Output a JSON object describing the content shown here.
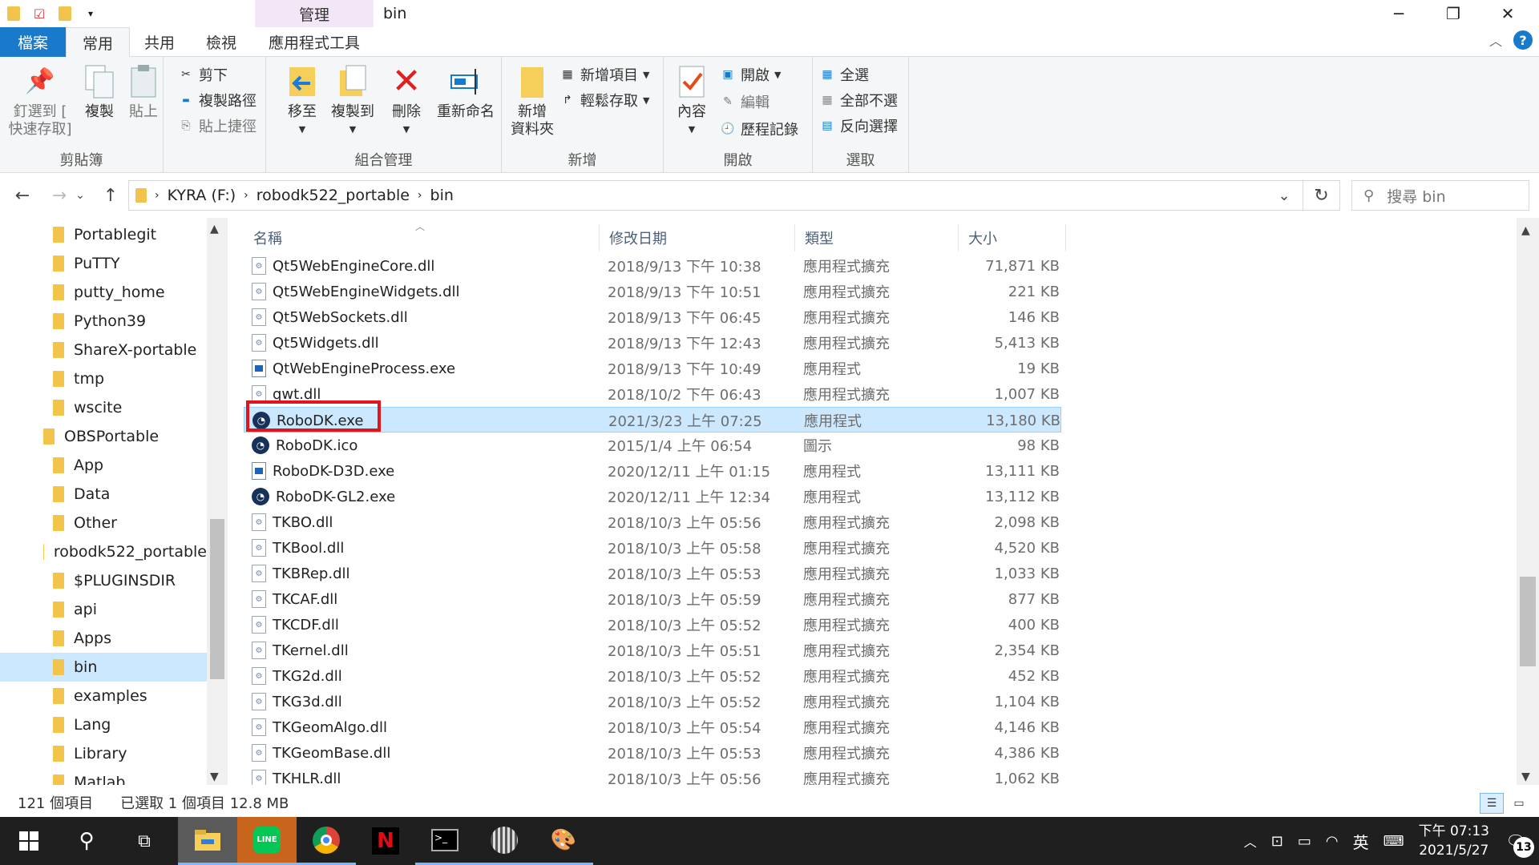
{
  "window": {
    "title": "bin",
    "context_tab": "管理",
    "controls": {
      "minimize": "─",
      "maximize": "❐",
      "close": "✕"
    }
  },
  "ribbon_tabs": [
    {
      "label": "檔案"
    },
    {
      "label": "常用"
    },
    {
      "label": "共用"
    },
    {
      "label": "檢視"
    },
    {
      "label": "應用程式工具"
    }
  ],
  "help_label": "?",
  "ribbon": {
    "clipboard": {
      "label": "剪貼簿",
      "pin": "釘選到 [\n快速存取]",
      "copy": "複製",
      "paste": "貼上",
      "cut": "剪下",
      "copy_path": "複製路徑",
      "paste_shortcut": "貼上捷徑"
    },
    "organize": {
      "label": "組合管理",
      "move_to": "移至",
      "copy_to": "複製到",
      "delete": "刪除",
      "rename": "重新命名"
    },
    "new": {
      "label": "新增",
      "new_folder": "新增\n資料夾",
      "new_item": "新增項目",
      "easy_access": "輕鬆存取"
    },
    "open": {
      "label": "開啟",
      "properties": "內容",
      "open": "開啟",
      "edit": "編輯",
      "history": "歷程記錄"
    },
    "select": {
      "label": "選取",
      "select_all": "全選",
      "select_none": "全部不選",
      "invert": "反向選擇"
    }
  },
  "address": {
    "crumbs": [
      "KYRA (F:)",
      "robodk522_portable",
      "bin"
    ],
    "search_placeholder": "搜尋 bin"
  },
  "nav_tree": [
    {
      "label": "Portablegit",
      "level": 2
    },
    {
      "label": "PuTTY",
      "level": 2
    },
    {
      "label": "putty_home",
      "level": 2
    },
    {
      "label": "Python39",
      "level": 2
    },
    {
      "label": "ShareX-portable",
      "level": 2
    },
    {
      "label": "tmp",
      "level": 2
    },
    {
      "label": "wscite",
      "level": 2
    },
    {
      "label": "OBSPortable",
      "level": 1
    },
    {
      "label": "App",
      "level": 2
    },
    {
      "label": "Data",
      "level": 2
    },
    {
      "label": "Other",
      "level": 2
    },
    {
      "label": "robodk522_portable",
      "level": 1
    },
    {
      "label": "$PLUGINSDIR",
      "level": 2
    },
    {
      "label": "api",
      "level": 2
    },
    {
      "label": "Apps",
      "level": 2
    },
    {
      "label": "bin",
      "level": 2,
      "selected": true
    },
    {
      "label": "examples",
      "level": 2
    },
    {
      "label": "Lang",
      "level": 2
    },
    {
      "label": "Library",
      "level": 2
    },
    {
      "label": "Matlab",
      "level": 2
    }
  ],
  "columns": {
    "name": "名稱",
    "date": "修改日期",
    "type": "類型",
    "size": "大小"
  },
  "files": [
    {
      "name": "Qt5WebEngineCore.dll",
      "date": "2018/9/13 下午 10:38",
      "type": "應用程式擴充",
      "size": "71,871 KB",
      "icon": "dll"
    },
    {
      "name": "Qt5WebEngineWidgets.dll",
      "date": "2018/9/13 下午 10:51",
      "type": "應用程式擴充",
      "size": "221 KB",
      "icon": "dll"
    },
    {
      "name": "Qt5WebSockets.dll",
      "date": "2018/9/13 下午 06:45",
      "type": "應用程式擴充",
      "size": "146 KB",
      "icon": "dll"
    },
    {
      "name": "Qt5Widgets.dll",
      "date": "2018/9/13 下午 12:43",
      "type": "應用程式擴充",
      "size": "5,413 KB",
      "icon": "dll"
    },
    {
      "name": "QtWebEngineProcess.exe",
      "date": "2018/9/13 下午 10:49",
      "type": "應用程式",
      "size": "19 KB",
      "icon": "exe"
    },
    {
      "name": "qwt.dll",
      "date": "2018/10/2 下午 06:43",
      "type": "應用程式擴充",
      "size": "1,007 KB",
      "icon": "dll"
    },
    {
      "name": "RoboDK.exe",
      "date": "2021/3/23 上午 07:25",
      "type": "應用程式",
      "size": "13,180 KB",
      "icon": "robo",
      "selected": true
    },
    {
      "name": "RoboDK.ico",
      "date": "2015/1/4 上午 06:54",
      "type": "圖示",
      "size": "98 KB",
      "icon": "robo"
    },
    {
      "name": "RoboDK-D3D.exe",
      "date": "2020/12/11 上午 01:15",
      "type": "應用程式",
      "size": "13,111 KB",
      "icon": "exe"
    },
    {
      "name": "RoboDK-GL2.exe",
      "date": "2020/12/11 上午 12:34",
      "type": "應用程式",
      "size": "13,112 KB",
      "icon": "robo"
    },
    {
      "name": "TKBO.dll",
      "date": "2018/10/3 上午 05:56",
      "type": "應用程式擴充",
      "size": "2,098 KB",
      "icon": "dll"
    },
    {
      "name": "TKBool.dll",
      "date": "2018/10/3 上午 05:58",
      "type": "應用程式擴充",
      "size": "4,520 KB",
      "icon": "dll"
    },
    {
      "name": "TKBRep.dll",
      "date": "2018/10/3 上午 05:53",
      "type": "應用程式擴充",
      "size": "1,033 KB",
      "icon": "dll"
    },
    {
      "name": "TKCAF.dll",
      "date": "2018/10/3 上午 05:59",
      "type": "應用程式擴充",
      "size": "877 KB",
      "icon": "dll"
    },
    {
      "name": "TKCDF.dll",
      "date": "2018/10/3 上午 05:52",
      "type": "應用程式擴充",
      "size": "400 KB",
      "icon": "dll"
    },
    {
      "name": "TKernel.dll",
      "date": "2018/10/3 上午 05:51",
      "type": "應用程式擴充",
      "size": "2,354 KB",
      "icon": "dll"
    },
    {
      "name": "TKG2d.dll",
      "date": "2018/10/3 上午 05:52",
      "type": "應用程式擴充",
      "size": "452 KB",
      "icon": "dll"
    },
    {
      "name": "TKG3d.dll",
      "date": "2018/10/3 上午 05:52",
      "type": "應用程式擴充",
      "size": "1,104 KB",
      "icon": "dll"
    },
    {
      "name": "TKGeomAlgo.dll",
      "date": "2018/10/3 上午 05:54",
      "type": "應用程式擴充",
      "size": "4,146 KB",
      "icon": "dll"
    },
    {
      "name": "TKGeomBase.dll",
      "date": "2018/10/3 上午 05:53",
      "type": "應用程式擴充",
      "size": "4,386 KB",
      "icon": "dll"
    },
    {
      "name": "TKHLR.dll",
      "date": "2018/10/3 上午 05:56",
      "type": "應用程式擴充",
      "size": "1,062 KB",
      "icon": "dll"
    }
  ],
  "status": {
    "count": "121 個項目",
    "selected": "已選取 1 個項目  12.8 MB"
  },
  "taskbar": {
    "apps": [
      "start",
      "search",
      "task-view",
      "file-explorer",
      "line",
      "chrome",
      "netflix",
      "terminal",
      "robodk",
      "paint"
    ],
    "tray_lang": "英",
    "time": "下午 07:13",
    "date": "2021/5/27",
    "notifications": "13"
  },
  "colors": {
    "accent": "#1979ca",
    "selection": "#cce8ff",
    "highlight_box": "#e2141c",
    "taskbar": "#1f1f1f"
  }
}
